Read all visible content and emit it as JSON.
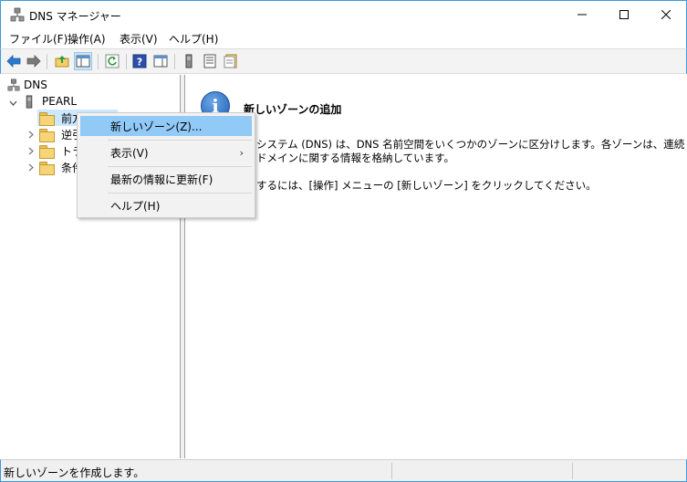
{
  "window": {
    "title": "DNS マネージャー"
  },
  "menu": [
    "ファイル(F)",
    "操作(A)",
    "表示(V)",
    "ヘルプ(H)"
  ],
  "toolbar": {
    "icons": [
      "back-icon",
      "forward-icon",
      "up-folder-icon",
      "show-hide-tree-icon",
      "refresh-icon",
      "help-icon",
      "action-pane-icon",
      "server-icon",
      "list-icon",
      "properties-icon"
    ]
  },
  "tree": {
    "root": "DNS",
    "server": "PEARL",
    "children": [
      "前方",
      "逆引",
      "トラ",
      "条件"
    ]
  },
  "context_menu": {
    "items": [
      {
        "label": "新しいゾーン(Z)...",
        "highlighted": true
      },
      {
        "label": "表示(V)",
        "submenu": true
      },
      {
        "label": "最新の情報に更新(F)"
      },
      {
        "label": "ヘルプ(H)"
      }
    ],
    "submenu_arrow": "›"
  },
  "info": {
    "title": "新しいゾーンの追加",
    "para1_line1": "システム (DNS) は、DNS 名前空間をいくつかのゾーンに区分けします。各ゾーンは、連続したい",
    "para1_line2": "ドメインに関する情報を格納しています。",
    "para2": "するには、[操作] メニューの [新しいゾーン] をクリックしてください。"
  },
  "status": {
    "text": "新しいゾーンを作成します。"
  }
}
